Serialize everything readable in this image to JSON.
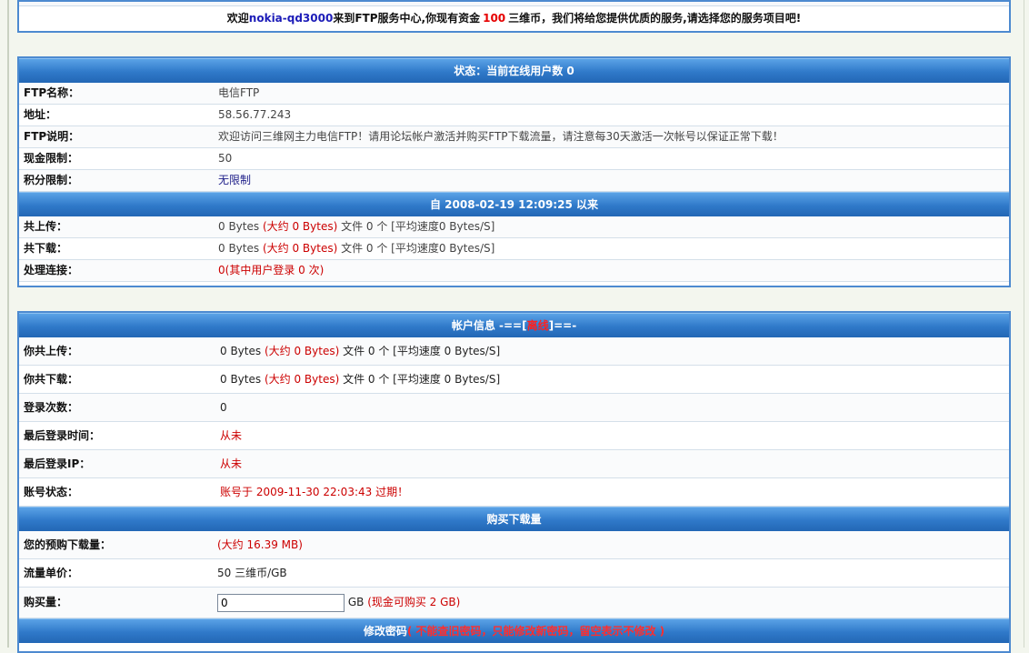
{
  "welcome": {
    "prefix": "欢迎",
    "username": "nokia-qd3000",
    "middle": "来到FTP服务中心,你现有资金",
    "money": "100",
    "suffix": "三维币，我们将给您提供优质的服务,请选择您的服务项目吧!"
  },
  "status": {
    "header": "状态：当前在线用户数 0",
    "rows": [
      {
        "label": "FTP名称：",
        "value": "电信FTP"
      },
      {
        "label": "地址：",
        "value": "58.56.77.243"
      },
      {
        "label": "FTP说明：",
        "value": "欢迎访问三维网主力电信FTP！请用论坛帐户激活并购买FTP下载流量，请注意每30天激活一次帐号以保证正常下载！"
      },
      {
        "label": "现金限制：",
        "value": "50"
      },
      {
        "label": "积分限制：",
        "value": "无限制"
      }
    ],
    "since_header": "自 2008-02-19 12:09:25 以来",
    "upload": {
      "label": "共上传：",
      "a": "0 Bytes",
      "b": "(大约 0 Bytes)",
      "c": "文件 0 个 [平均速度0 Bytes/S]"
    },
    "download": {
      "label": "共下载：",
      "a": "0 Bytes",
      "b": "(大约 0 Bytes)",
      "c": "文件 0 个 [平均速度0 Bytes/S]"
    },
    "connections": {
      "label": "处理连接：",
      "a": "0",
      "b": "(其中用户登录 0 次)"
    }
  },
  "account": {
    "header_prefix": "帐户信息 -==[",
    "header_status": "离线",
    "header_suffix": "]==-",
    "my_upload": {
      "label": "你共上传：",
      "a": "0 Bytes",
      "b": "(大约 0 Bytes)",
      "c": "文件 0 个 [平均速度 0 Bytes/S]"
    },
    "my_download": {
      "label": "你共下载：",
      "a": "0 Bytes",
      "b": "(大约 0 Bytes)",
      "c": "文件 0 个 [平均速度 0 Bytes/S]"
    },
    "login_count": {
      "label": "登录次数：",
      "value": "0"
    },
    "last_login_time": {
      "label": "最后登录时间：",
      "value": "从未"
    },
    "last_login_ip": {
      "label": "最后登录IP：",
      "value": "从未"
    },
    "account_status": {
      "label": "账号状态：",
      "value": "账号于 2009-11-30 22:03:43 过期！"
    }
  },
  "purchase": {
    "header": "购买下载量",
    "prebuy": {
      "label": "您的预购下载量：",
      "value": "(大约 16.39 MB)"
    },
    "unit_price": {
      "label": "流量单价：",
      "value": "50 三维币/GB"
    },
    "quantity": {
      "label": "购买量：",
      "input_value": "0",
      "unit": "GB",
      "note": "(现金可购买 2 GB)"
    }
  },
  "password": {
    "header": "修改密码",
    "note": "( 不能查旧密码，只能修改新密码，留空表示不修改 )"
  },
  "colors": {
    "header_blue": "#2f79c9",
    "border_blue": "#4d8ad0",
    "accent_red": "#cc0000",
    "user_blue": "#1c1cb8"
  }
}
